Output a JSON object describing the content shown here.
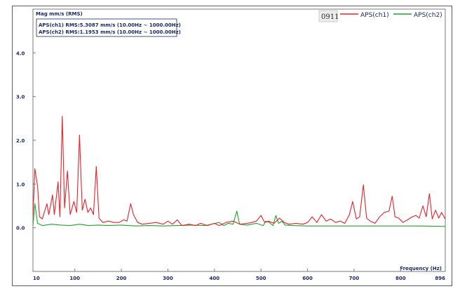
{
  "chart_data": {
    "type": "line",
    "ylabel": "Mag mm/s (RMS)",
    "xlabel": "Frequency (Hz)",
    "xlim": [
      10,
      896
    ],
    "ylim": [
      -1.0,
      5.0
    ],
    "x_ticks": [
      "10",
      "100",
      "200",
      "300",
      "400",
      "500",
      "600",
      "700",
      "800",
      "896"
    ],
    "y_ticks": [
      "4.0",
      "3.0",
      "2.0",
      "1.0",
      "0.0"
    ],
    "rms_lines": [
      "APS(ch1) RMS:5.3087 mm/s   (10.00Hz ~ 1000.00Hz)",
      "APS(ch2) RMS:1.1953 mm/s   (10.00Hz ~ 1000.00Hz)"
    ],
    "legend_code": "0911",
    "grid": false,
    "legend_position": "top-right",
    "series": [
      {
        "name": "APS(ch1)",
        "color": "#e8202a",
        "points": [
          [
            10,
            0.28
          ],
          [
            14,
            1.35
          ],
          [
            20,
            0.95
          ],
          [
            24,
            0.25
          ],
          [
            30,
            0.2
          ],
          [
            40,
            0.55
          ],
          [
            44,
            0.3
          ],
          [
            52,
            0.75
          ],
          [
            56,
            0.3
          ],
          [
            64,
            1.05
          ],
          [
            68,
            0.25
          ],
          [
            73,
            2.55
          ],
          [
            78,
            0.45
          ],
          [
            84,
            1.3
          ],
          [
            90,
            0.3
          ],
          [
            98,
            0.6
          ],
          [
            104,
            0.35
          ],
          [
            110,
            2.12
          ],
          [
            116,
            0.4
          ],
          [
            122,
            0.65
          ],
          [
            128,
            0.35
          ],
          [
            134,
            0.45
          ],
          [
            140,
            0.3
          ],
          [
            146,
            1.4
          ],
          [
            152,
            0.22
          ],
          [
            160,
            0.12
          ],
          [
            172,
            0.15
          ],
          [
            185,
            0.12
          ],
          [
            195,
            0.12
          ],
          [
            205,
            0.18
          ],
          [
            212,
            0.15
          ],
          [
            220,
            0.55
          ],
          [
            226,
            0.3
          ],
          [
            235,
            0.12
          ],
          [
            245,
            0.08
          ],
          [
            260,
            0.1
          ],
          [
            275,
            0.12
          ],
          [
            290,
            0.08
          ],
          [
            300,
            0.15
          ],
          [
            310,
            0.08
          ],
          [
            320,
            0.18
          ],
          [
            330,
            0.05
          ],
          [
            345,
            0.08
          ],
          [
            360,
            0.05
          ],
          [
            370,
            0.1
          ],
          [
            385,
            0.05
          ],
          [
            400,
            0.1
          ],
          [
            410,
            0.05
          ],
          [
            425,
            0.12
          ],
          [
            440,
            0.15
          ],
          [
            455,
            0.08
          ],
          [
            470,
            0.1
          ],
          [
            480,
            0.12
          ],
          [
            490,
            0.15
          ],
          [
            500,
            0.28
          ],
          [
            508,
            0.12
          ],
          [
            516,
            0.15
          ],
          [
            528,
            0.1
          ],
          [
            540,
            0.22
          ],
          [
            550,
            0.12
          ],
          [
            560,
            0.08
          ],
          [
            575,
            0.1
          ],
          [
            590,
            0.08
          ],
          [
            600,
            0.12
          ],
          [
            610,
            0.25
          ],
          [
            620,
            0.12
          ],
          [
            630,
            0.3
          ],
          [
            640,
            0.15
          ],
          [
            650,
            0.2
          ],
          [
            660,
            0.12
          ],
          [
            670,
            0.15
          ],
          [
            680,
            0.1
          ],
          [
            690,
            0.3
          ],
          [
            697,
            0.6
          ],
          [
            705,
            0.2
          ],
          [
            712,
            0.25
          ],
          [
            720,
            0.98
          ],
          [
            727,
            0.22
          ],
          [
            735,
            0.15
          ],
          [
            745,
            0.1
          ],
          [
            755,
            0.25
          ],
          [
            765,
            0.35
          ],
          [
            775,
            0.38
          ],
          [
            782,
            0.72
          ],
          [
            788,
            0.25
          ],
          [
            796,
            0.22
          ],
          [
            805,
            0.12
          ],
          [
            815,
            0.18
          ],
          [
            825,
            0.25
          ],
          [
            833,
            0.28
          ],
          [
            840,
            0.22
          ],
          [
            848,
            0.5
          ],
          [
            855,
            0.25
          ],
          [
            862,
            0.78
          ],
          [
            868,
            0.2
          ],
          [
            875,
            0.4
          ],
          [
            882,
            0.22
          ],
          [
            888,
            0.35
          ],
          [
            896,
            0.2
          ]
        ]
      },
      {
        "name": "APS(ch2)",
        "color": "#22a12e",
        "points": [
          [
            10,
            0.05
          ],
          [
            14,
            0.55
          ],
          [
            20,
            0.1
          ],
          [
            30,
            0.05
          ],
          [
            50,
            0.08
          ],
          [
            70,
            0.06
          ],
          [
            90,
            0.05
          ],
          [
            110,
            0.08
          ],
          [
            130,
            0.05
          ],
          [
            150,
            0.06
          ],
          [
            170,
            0.05
          ],
          [
            200,
            0.06
          ],
          [
            230,
            0.04
          ],
          [
            260,
            0.05
          ],
          [
            290,
            0.04
          ],
          [
            320,
            0.05
          ],
          [
            350,
            0.06
          ],
          [
            380,
            0.05
          ],
          [
            410,
            0.12
          ],
          [
            420,
            0.05
          ],
          [
            430,
            0.1
          ],
          [
            440,
            0.08
          ],
          [
            448,
            0.38
          ],
          [
            454,
            0.08
          ],
          [
            470,
            0.06
          ],
          [
            490,
            0.1
          ],
          [
            505,
            0.05
          ],
          [
            510,
            0.15
          ],
          [
            518,
            0.12
          ],
          [
            526,
            0.05
          ],
          [
            532,
            0.28
          ],
          [
            538,
            0.1
          ],
          [
            545,
            0.15
          ],
          [
            552,
            0.06
          ],
          [
            570,
            0.05
          ],
          [
            600,
            0.04
          ],
          [
            640,
            0.04
          ],
          [
            680,
            0.04
          ],
          [
            720,
            0.04
          ],
          [
            760,
            0.04
          ],
          [
            800,
            0.04
          ],
          [
            840,
            0.04
          ],
          [
            896,
            0.03
          ]
        ]
      }
    ]
  }
}
